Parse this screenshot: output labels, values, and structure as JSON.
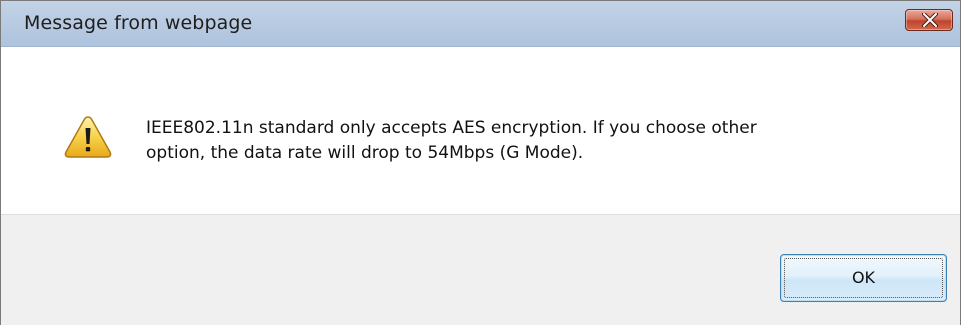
{
  "window": {
    "title": "Message from webpage"
  },
  "title_bar": {
    "close_icon": "close-icon"
  },
  "dialog": {
    "icon": "warning-icon",
    "message_line1": "IEEE802.11n standard only accepts AES encryption. If you choose other",
    "message_line2": "option, the data rate will drop to 54Mbps (G Mode)."
  },
  "buttons": {
    "ok_label": "OK"
  },
  "colors": {
    "titlebar": "#b9cbe2",
    "close_button": "#c0442c",
    "footer": "#f0f0f0",
    "ok_button_border": "#3c7fb1",
    "warning_fill": "#f7c93a"
  }
}
